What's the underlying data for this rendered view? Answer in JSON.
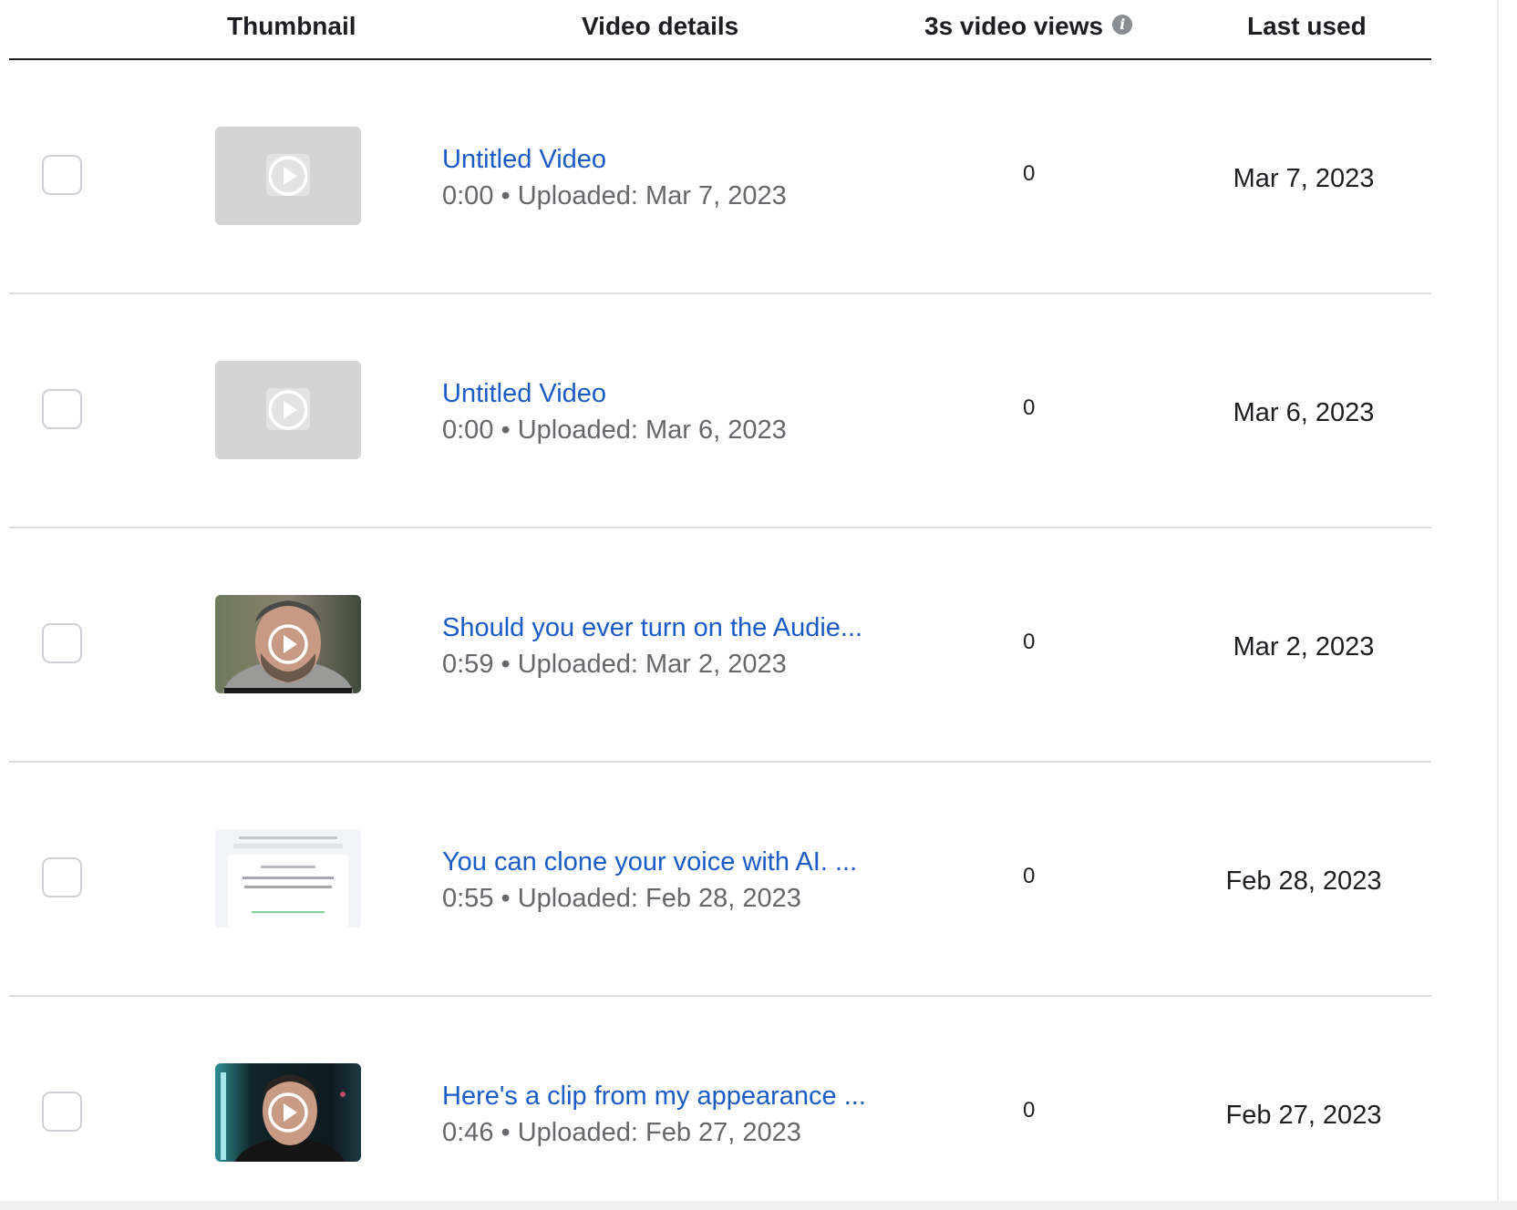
{
  "table": {
    "headers": {
      "thumbnail": "Thumbnail",
      "video_details": "Video details",
      "views": "3s video views",
      "last_used": "Last used"
    },
    "rows": [
      {
        "title": "Untitled Video",
        "meta": "0:00 • Uploaded: Mar 7, 2023",
        "views": "0",
        "last_used": "Mar 7, 2023",
        "thumbnail": "placeholder"
      },
      {
        "title": "Untitled Video",
        "meta": "0:00 • Uploaded: Mar 6, 2023",
        "views": "0",
        "last_used": "Mar 6, 2023",
        "thumbnail": "placeholder"
      },
      {
        "title": "Should you ever turn on the Audie...",
        "meta": "0:59 • Uploaded: Mar 2, 2023",
        "views": "0",
        "last_used": "Mar 2, 2023",
        "thumbnail": "person-portrait"
      },
      {
        "title": "You can clone your voice with AI. ...",
        "meta": "0:55 • Uploaded: Feb 28, 2023",
        "views": "0",
        "last_used": "Feb 28, 2023",
        "thumbnail": "document-screenshot"
      },
      {
        "title": "Here's a clip from my appearance ...",
        "meta": "0:46 • Uploaded: Feb 27, 2023",
        "views": "0",
        "last_used": "Feb 27, 2023",
        "thumbnail": "person-dark-studio"
      }
    ]
  },
  "colors": {
    "link": "#1a5bc6",
    "meta_text": "#65676b",
    "header_text": "#1c1e21",
    "divider": "#dadde1",
    "placeholder_thumb": "#d4d4d4"
  }
}
